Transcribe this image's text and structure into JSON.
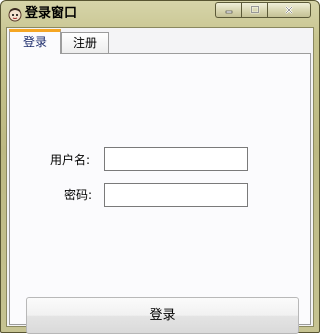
{
  "window": {
    "title": "登录窗口",
    "controls": [
      "minimize-icon",
      "maximize-icon",
      "close-icon"
    ]
  },
  "tabs": [
    {
      "label": "登录",
      "active": true
    },
    {
      "label": "注册",
      "active": false
    }
  ],
  "form": {
    "username_label": "用户名:",
    "username_value": "",
    "password_label": "密码:",
    "password_value": ""
  },
  "login_button_label": "登录",
  "colors": {
    "active_tab_accent": "#f5a623",
    "frame": "#c7c48e"
  }
}
